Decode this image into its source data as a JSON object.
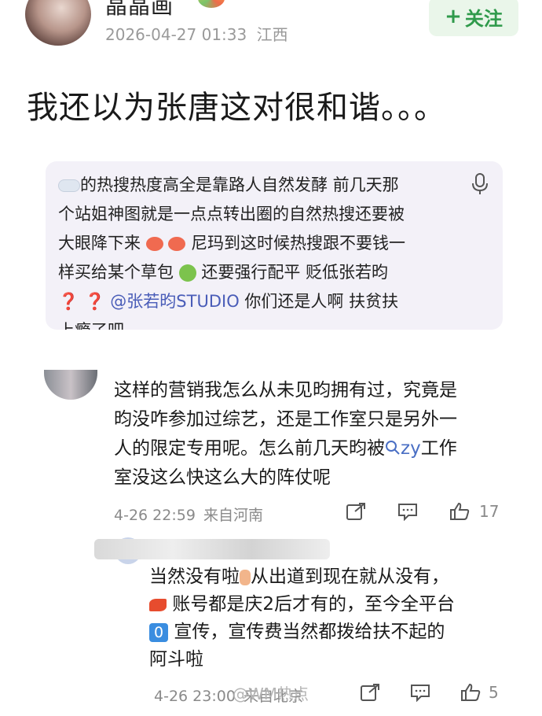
{
  "header": {
    "username": "晶晶画",
    "timestamp": "2026-04-27 01:33",
    "location": "江西",
    "follow_label": "关注"
  },
  "post": {
    "text": "我还以为张唐这对很和谐。。。"
  },
  "embedded": {
    "line1": "的热搜热度高全是靠路人自然发酵 前几天那",
    "line2": "个站姐神图就是一点点转出圈的自然热搜还要被",
    "line3a": "大眼降下来",
    "line3b": " 尼玛到这时候热搜跟不要钱一",
    "line4a": "样买给某个草包 ",
    "line4b": "还要强行配平 贬低张若昀",
    "q_marks": "❓ ❓",
    "mention": "@张若昀STUDIO",
    "line5b": " 你们还是人啊 扶贫扶",
    "line6": "上瘾了吧"
  },
  "comment": {
    "text1": "这样的营销我怎么从未见昀拥有过，究竟是",
    "text2": "昀没咋参加过综艺，还是工作室只是另外一",
    "text3a": "人的限定专用呢。怎么前几天昀被",
    "search_term": "zy",
    "text3b": "工作",
    "text4": "室没这么快这么大的阵仗呢",
    "time": "4-26 22:59",
    "from": "来自河南",
    "likes": "17"
  },
  "reply": {
    "line1a": "当然没有啦",
    "line1b": "从出道到现在就从没有，",
    "line2": "账号都是庆2后才有的，至今全平台",
    "zero_label": "0",
    "line3": "宣传，宣传费当然都拨给扶不起的",
    "line4": "阿斗啦",
    "time": "4-26 23:00",
    "from": "来自北京",
    "likes": "5"
  },
  "watermark": "@WM热点",
  "colors": {
    "follow_bg": "#eaf6ea",
    "follow_text": "#2f9a4b",
    "mention": "#4a5db8",
    "meta": "#9a9a9a"
  }
}
